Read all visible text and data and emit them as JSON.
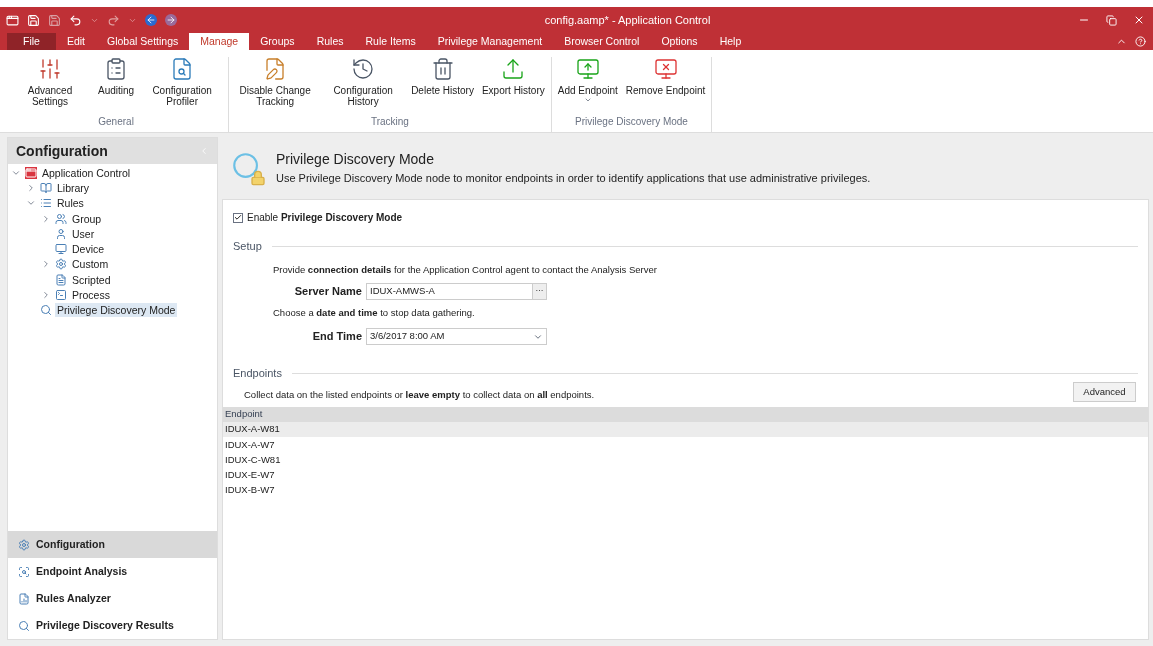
{
  "window": {
    "title": "config.aamp* - Application Control"
  },
  "menu_tabs": [
    {
      "label": "File",
      "kind": "file",
      "selected": false
    },
    {
      "label": "Edit",
      "kind": "tab",
      "selected": false
    },
    {
      "label": "Global Settings",
      "kind": "tab",
      "selected": false
    },
    {
      "label": "Manage",
      "kind": "tab",
      "selected": true
    },
    {
      "label": "Groups",
      "kind": "tab",
      "selected": false
    },
    {
      "label": "Rules",
      "kind": "tab",
      "selected": false
    },
    {
      "label": "Rule Items",
      "kind": "tab",
      "selected": false
    },
    {
      "label": "Privilege Management",
      "kind": "tab",
      "selected": false
    },
    {
      "label": "Browser Control",
      "kind": "tab",
      "selected": false
    },
    {
      "label": "Options",
      "kind": "tab",
      "selected": false
    },
    {
      "label": "Help",
      "kind": "tab",
      "selected": false
    }
  ],
  "ribbon": [
    {
      "label": "General",
      "buttons": [
        {
          "label": "Advanced Settings",
          "kind": "plain"
        },
        {
          "label": "Auditing",
          "kind": "plain"
        },
        {
          "label": "Configuration Profiler",
          "kind": "plain"
        }
      ]
    },
    {
      "label": "Tracking",
      "buttons": [
        {
          "label": "Disable Change Tracking",
          "kind": "plain"
        },
        {
          "label": "Configuration History",
          "kind": "plain"
        },
        {
          "label": "Delete History",
          "kind": "plain"
        },
        {
          "label": "Export History",
          "kind": "plain"
        }
      ]
    },
    {
      "label": "Privilege Discovery Mode",
      "buttons": [
        {
          "label": "Add Endpoint",
          "kind": "dropdown"
        },
        {
          "label": "Remove Endpoint",
          "kind": "plain"
        }
      ]
    }
  ],
  "sidebar": {
    "title": "Configuration",
    "tree": [
      {
        "label": "Application Control",
        "expanded": true,
        "selected": false,
        "children": [
          {
            "label": "Library",
            "expanded": false,
            "selected": false
          },
          {
            "label": "Rules",
            "expanded": true,
            "selected": false,
            "children": [
              {
                "label": "Group",
                "expanded": false,
                "selected": false
              },
              {
                "label": "User",
                "selected": false
              },
              {
                "label": "Device",
                "selected": false
              },
              {
                "label": "Custom",
                "expanded": false,
                "selected": false
              },
              {
                "label": "Scripted",
                "selected": false
              },
              {
                "label": "Process",
                "expanded": false,
                "selected": false
              }
            ]
          },
          {
            "label": "Privilege Discovery Mode",
            "selected": true
          }
        ]
      }
    ],
    "nav": [
      {
        "label": "Configuration",
        "selected": true
      },
      {
        "label": "Endpoint Analysis",
        "selected": false
      },
      {
        "label": "Rules Analyzer",
        "selected": false
      },
      {
        "label": "Privilege Discovery Results",
        "selected": false
      }
    ]
  },
  "header": {
    "title": "Privilege Discovery Mode",
    "description": "Use Privilege Discovery Mode node to monitor endpoints in order to identify applications that use administrative privileges."
  },
  "enable": {
    "label": "Enable **Privilege Discovery Mode**",
    "checked": true
  },
  "setup": {
    "title": "Setup",
    "server_hint": "Provide **connection details** for the Application Control agent to contact the Analysis Server",
    "server_label": "Server Name",
    "server_value": "IDUX-AMWS-A",
    "browse": "···",
    "time_hint": "Choose a **date and time** to stop data gathering.",
    "time_label": "End Time",
    "time_value": "3/6/2017 8:00 AM"
  },
  "endpoints": {
    "title": "Endpoints",
    "hint": "Collect data on the listed endpoints or **leave empty** to collect data on **all** endpoints.",
    "advanced": "Advanced",
    "column": "Endpoint",
    "rows": [
      {
        "name": "IDUX-A-W81",
        "selected": true
      },
      {
        "name": "IDUX-A-W7",
        "selected": false
      },
      {
        "name": "IDUX-C-W81",
        "selected": false
      },
      {
        "name": "IDUX-E-W7",
        "selected": false
      },
      {
        "name": "IDUX-B-W7",
        "selected": false
      }
    ]
  }
}
